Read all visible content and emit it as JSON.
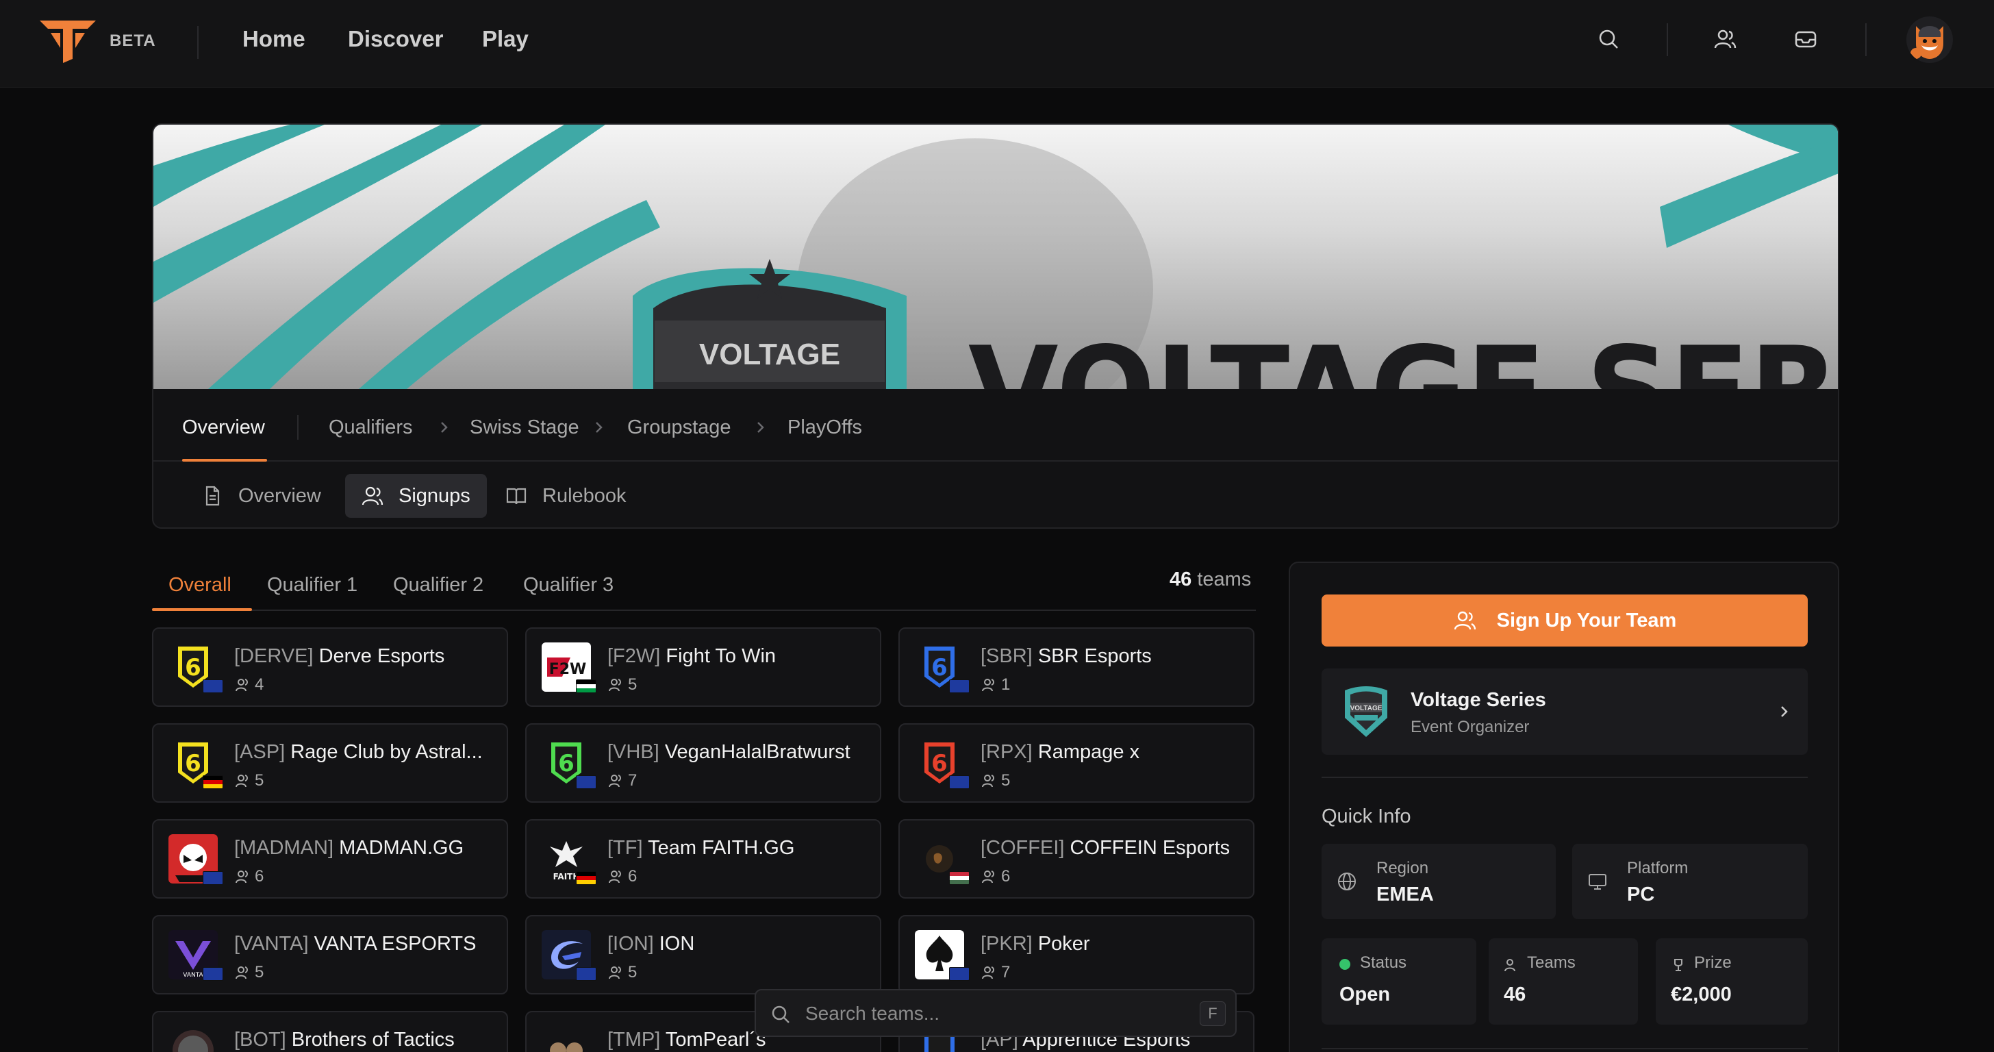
{
  "topnav": {
    "beta_label": "BETA",
    "links": [
      "Home",
      "Discover",
      "Play"
    ],
    "icons": [
      "search-icon",
      "users-icon",
      "inbox-icon"
    ]
  },
  "banner": {
    "event_title": "VOLTAGE SERIES",
    "badge_text": "VOLTAGE"
  },
  "stage_tabs": [
    "Overview",
    "Qualifiers",
    "Swiss Stage",
    "Groupstage",
    "PlayOffs"
  ],
  "sub_tabs": [
    "Overview",
    "Signups",
    "Rulebook"
  ],
  "group_tabs": [
    "Overall",
    "Qualifier 1",
    "Qualifier 2",
    "Qualifier 3"
  ],
  "team_count": {
    "number": "46",
    "label": "teams"
  },
  "teams": [
    {
      "tag": "[DERVE]",
      "name": "Derve Esports",
      "members": "4"
    },
    {
      "tag": "[F2W]",
      "name": "Fight To Win",
      "members": "5"
    },
    {
      "tag": "[SBR]",
      "name": "SBR Esports",
      "members": "1"
    },
    {
      "tag": "[ASP]",
      "name": "Rage Club by Astral...",
      "members": "5"
    },
    {
      "tag": "[VHB]",
      "name": "VeganHalalBratwurst",
      "members": "7"
    },
    {
      "tag": "[RPX]",
      "name": "Rampage x",
      "members": "5"
    },
    {
      "tag": "[MADMAN]",
      "name": "MADMAN.GG",
      "members": "6"
    },
    {
      "tag": "[TF]",
      "name": "Team FAITH.GG",
      "members": "6"
    },
    {
      "tag": "[COFFEI]",
      "name": "COFFEIN Esports",
      "members": "6"
    },
    {
      "tag": "[VANTA]",
      "name": "VANTA ESPORTS",
      "members": "5"
    },
    {
      "tag": "[ION]",
      "name": "ION",
      "members": "5"
    },
    {
      "tag": "[PKR]",
      "name": "Poker",
      "members": "7"
    },
    {
      "tag": "[BOT]",
      "name": "Brothers of Tactics",
      "members": ""
    },
    {
      "tag": "[TMP]",
      "name": "TomPearl´s",
      "members": ""
    },
    {
      "tag": "[AP]",
      "name": "Apprentice Esports",
      "members": ""
    }
  ],
  "search": {
    "placeholder": "Search teams...",
    "shortcut": "F"
  },
  "side": {
    "signup_label": "Sign Up Your Team",
    "organizer": {
      "name": "Voltage Series",
      "role": "Event Organizer"
    },
    "quick_info_title": "Quick Info",
    "region": {
      "label": "Region",
      "value": "EMEA"
    },
    "platform": {
      "label": "Platform",
      "value": "PC"
    },
    "status": {
      "label": "Status",
      "value": "Open"
    },
    "teams": {
      "label": "Teams",
      "value": "46"
    },
    "prize": {
      "label": "Prize",
      "value": "€2,000"
    }
  },
  "colors": {
    "accent": "#f0813a",
    "teal": "#3fa9a6",
    "status_open": "#35c26b"
  }
}
